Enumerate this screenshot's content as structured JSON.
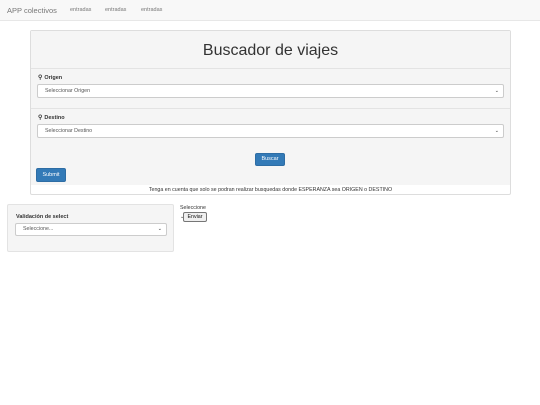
{
  "navbar": {
    "brand": "APP colectivos",
    "links": [
      "entradas",
      "entradas",
      "entradas"
    ]
  },
  "search": {
    "title": "Buscador de viajes",
    "origin_label": "Origen",
    "origin_value": "Seleccionar Origen",
    "destination_label": "Destino",
    "destination_value": "Seleccionar Destino",
    "search_button": "Buscar",
    "submit_button": "Submit",
    "note": "Tenga en cuenta que solo se podran realizar busquedas donde ESPERANZA sea ORIGEN o DESTINO"
  },
  "validation": {
    "title": "Validación de select",
    "select_value": "Seleccione..."
  },
  "side": {
    "label": "Seleccione",
    "send_button": "Enviar"
  },
  "icons": {
    "pin": "map-marker-icon",
    "caret": "chevron-down-icon"
  },
  "colors": {
    "primary": "#337ab7",
    "navbar_bg": "#f8f8f8",
    "panel_bg": "#f5f5f5"
  }
}
